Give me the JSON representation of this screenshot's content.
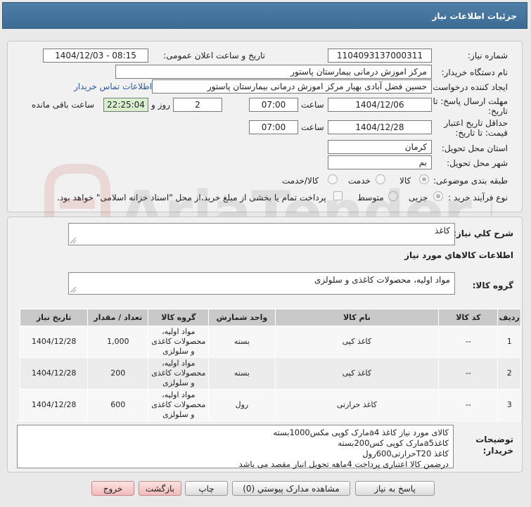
{
  "header": {
    "title": "جزئیات اطلاعات نیاز"
  },
  "need": {
    "number_label": "شماره نیاز:",
    "number": "1104093137000311",
    "announce_label": "تاریخ و ساعت اعلان عمومی:",
    "announce_value": "1404/12/03 - 08:15",
    "buyer_label": "نام دستگاه خریدار:",
    "buyer": "مرکز اموزش درمانی بیمارستان پاستور",
    "creator_label": "ایجاد کننده درخواست:",
    "creator": "حسین فضل آبادی بهیار مرکز اموزش درمانی بیمارستان پاستور",
    "contact_link": "اطلاعات تماس خریدار",
    "deadline_label": "مهلت ارسال پاسخ: تا تاریخ:",
    "deadline_date": "1404/12/06",
    "time_label": "ساعت",
    "deadline_time": "07:00",
    "days_value": "2",
    "days_label": "روز و",
    "remaining_time": "22:25:04",
    "remaining_label": "ساعت باقی مانده",
    "validity_label": "حداقل تاریخ اعتبار قیمت: تا تاریخ:",
    "validity_date": "1404/12/28",
    "validity_time": "07:00",
    "province_label": "استان محل تحویل:",
    "province": "کرمان",
    "city_label": "شهر محل تحویل:",
    "city": "بم",
    "category_label": "طبقه بندی موضوعی:",
    "category_options": [
      "کالا",
      "خدمت",
      "کالا/خدمت"
    ],
    "process_label": "نوع فرآیند خرید :",
    "process_options": [
      "جزیی",
      "متوسط"
    ],
    "payment_note": "پرداخت تمام یا بخشی از مبلغ خرید،از محل \"اسناد خزانه اسلامی\" خواهد بود."
  },
  "summary": {
    "label": "شرح کلي نياز:",
    "value": "کاغذ",
    "goods_info_title": "اطلاعات کالاهاي مورد نياز",
    "group_label": "گروه کالا:",
    "group_value": "مواد اولیه، محصولات کاغذی و سلولزی"
  },
  "table": {
    "headers": [
      "ردیف",
      "کد کالا",
      "نام کالا",
      "واحد شمارش",
      "گروه کالا",
      "تعداد / مقدار",
      "تاریخ نیاز"
    ],
    "rows": [
      [
        "1",
        "--",
        "کاغذ کپی",
        "بسته",
        "مواد اولیه، محصولات کاغذی و سلولزی",
        "1,000",
        "1404/12/28"
      ],
      [
        "2",
        "--",
        "کاغذ کپی",
        "بسته",
        "مواد اولیه، محصولات کاغذی و سلولزی",
        "200",
        "1404/12/28"
      ],
      [
        "3",
        "--",
        "کاغذ حرارتی",
        "رول",
        "مواد اولیه، محصولات کاغذی و سلولزی",
        "600",
        "1404/12/28"
      ]
    ]
  },
  "buyer_notes": {
    "label": "توضیحات خریدار:",
    "text": "کالای مورد نیاز کاغذ a4مارک کوپی مکس1000بسته\nکاغذa5مارک کوپی کس200بسته\nکاغذ T20حرارتی600رول\nدرضمن کالا اعتباری پرداخت 4ماهه تحویل انبار مقصد می باشد"
  },
  "buttons": {
    "reply": "پاسخ به نیاز",
    "attachments": "مشاهده مدارک پیوستي (0)",
    "print": "چاپ",
    "back": "بازگشت",
    "exit": "خروج"
  },
  "watermark": {
    "text": "AriaTender.neT"
  }
}
